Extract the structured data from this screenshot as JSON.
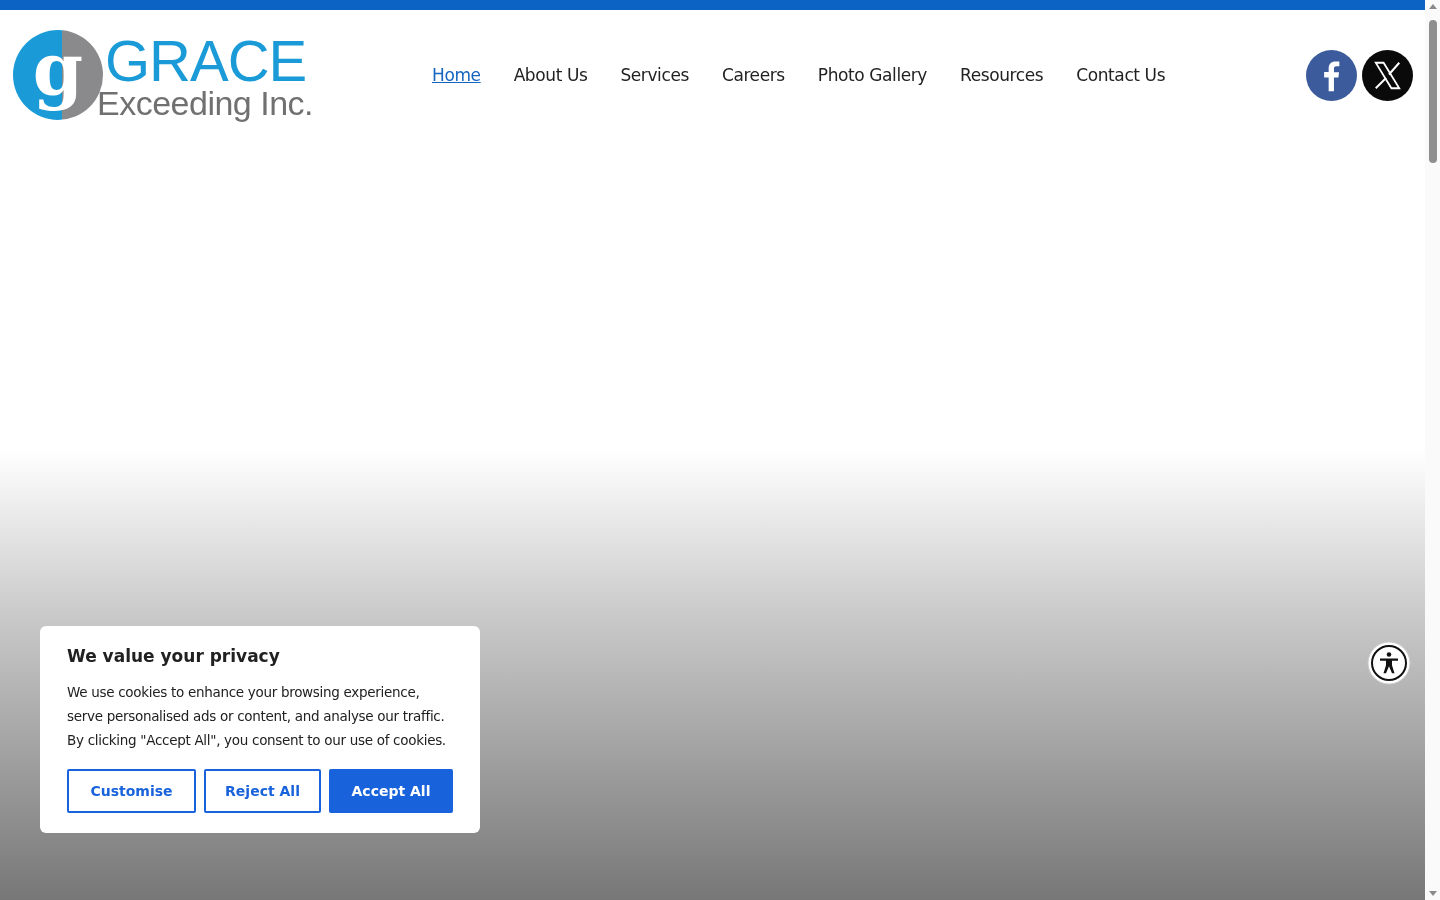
{
  "logo": {
    "monogram": "g",
    "name": "GRACE",
    "tagline": "Exceeding Inc."
  },
  "nav": [
    {
      "label": "Home",
      "selected": true
    },
    {
      "label": "About Us",
      "selected": false
    },
    {
      "label": "Services",
      "selected": false
    },
    {
      "label": "Careers",
      "selected": false
    },
    {
      "label": "Photo Gallery",
      "selected": false
    },
    {
      "label": "Resources",
      "selected": false
    },
    {
      "label": "Contact Us",
      "selected": false
    }
  ],
  "social": [
    {
      "kind": "facebook"
    },
    {
      "kind": "x"
    }
  ],
  "cookie_banner": {
    "title": "We value your privacy",
    "text": "We use cookies to enhance your browsing experience, serve personalised ads or content, and analyse our traffic. By clicking \"Accept All\", you consent to our use of cookies.",
    "buttons": [
      {
        "label": "Customise",
        "kind": "outline"
      },
      {
        "label": "Reject All",
        "kind": "outline"
      },
      {
        "label": "Accept All",
        "kind": "primary"
      }
    ]
  }
}
